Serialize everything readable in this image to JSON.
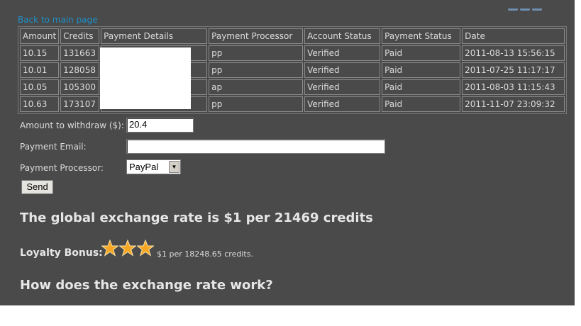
{
  "nav": {
    "back_link": "Back to main page"
  },
  "table": {
    "headers": [
      "Amount",
      "Credits",
      "Payment Details",
      "Payment Processor",
      "Account Status",
      "Payment Status",
      "Date"
    ],
    "rows": [
      [
        "10.15",
        "131663",
        "",
        "pp",
        "Verified",
        "Paid",
        "2011-08-13 15:56:15"
      ],
      [
        "10.01",
        "128058",
        "",
        "pp",
        "Verified",
        "Paid",
        "2011-07-25 11:17:17"
      ],
      [
        "10.05",
        "105300",
        "",
        "ap",
        "Verified",
        "Paid",
        "2011-08-03 11:15:43"
      ],
      [
        "10.63",
        "173107",
        "",
        "pp",
        "Verified",
        "Paid",
        "2011-11-07 23:09:32"
      ]
    ]
  },
  "form": {
    "amount_label": "Amount to withdraw ($):",
    "amount_value": "20.4",
    "email_label": "Payment Email:",
    "email_value": "",
    "processor_label": "Payment Processor:",
    "processor_value": "PayPal",
    "send_label": "Send"
  },
  "rate_heading": "The global exchange rate is $1 per 21469 credits",
  "loyalty": {
    "label": "Loyalty Bonus:",
    "stars": 3,
    "text": "$1 per 18248.65 credits."
  },
  "how_heading": "How does the exchange rate work?",
  "colors": {
    "panel": "#4a4a4a",
    "link": "#1e90c8",
    "text": "#dcdcdc",
    "star": "#f5a623"
  }
}
